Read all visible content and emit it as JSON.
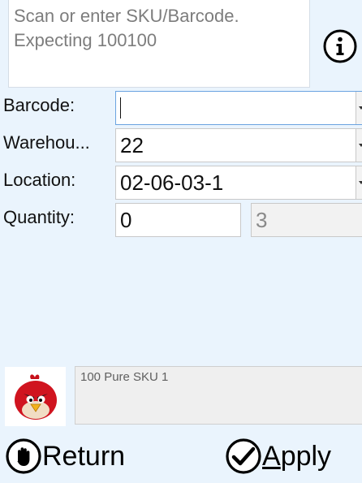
{
  "message": {
    "line1": "Scan or enter SKU/Barcode.",
    "line2": "Expecting 100100"
  },
  "form": {
    "barcode": {
      "label": "Barcode:",
      "value": ""
    },
    "warehouse": {
      "label": "Warehou...",
      "value": "22"
    },
    "location": {
      "label": "Location:",
      "value": "02-06-03-1"
    },
    "quantity": {
      "label": "Quantity:",
      "value": "0",
      "expected": "3"
    }
  },
  "item": {
    "description": "100 Pure SKU 1"
  },
  "actions": {
    "return_label": "Return",
    "apply_first": "A",
    "apply_rest": "pply"
  },
  "icons": {
    "info": "info-icon",
    "dropdown": "chevron-down-icon",
    "stop": "stop-hand-icon",
    "check": "checkmark-icon",
    "product": "red-bird-image"
  }
}
